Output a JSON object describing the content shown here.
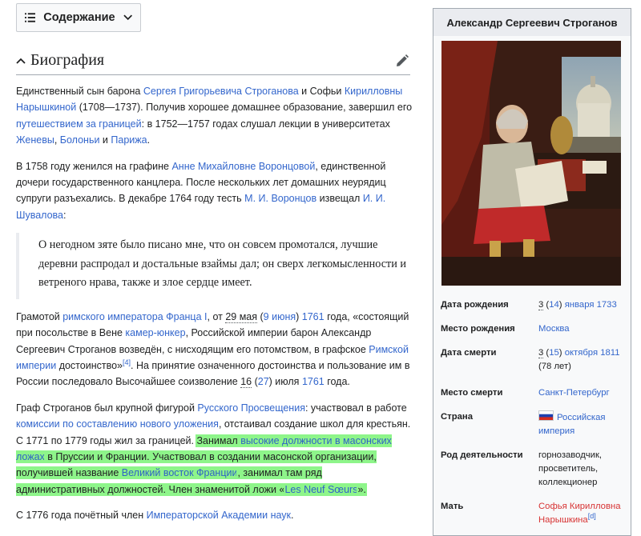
{
  "toc": {
    "label": "Содержание"
  },
  "section": {
    "title": "Биография"
  },
  "p1": {
    "t1": "Единственный сын барона ",
    "l1": "Сергея Григорьевича Строганова",
    "t2": " и Софьи ",
    "l2": "Кирилловны Нарышкиной",
    "t3": " (1708—1737). Получив хорошее домашнее образование, завершил его ",
    "l3": "путешествием за границей",
    "t4": ": в 1752—1757 годах слушал лекции в университетах ",
    "l4": "Женевы",
    "t5": ", ",
    "l5": "Болоньи",
    "t6": " и ",
    "l6": "Парижа",
    "t7": "."
  },
  "p2": {
    "t1": "В 1758 году женился на графине ",
    "l1": "Анне Михайловне Воронцовой",
    "t2": ", единственной дочери государственного канцлера. После нескольких лет домашних неурядиц супруги разъехались. В декабре 1764 году тесть ",
    "l2": "М. И. Воронцов",
    "t3": " извещал ",
    "l3": "И. И. Шувалова",
    "t4": ":"
  },
  "quote": "О негодном зяте было писано мне, что он совсем промотался, лучшие деревни распродал и достальные взаймы дал; он сверх легкомысленности и ветреного нрава, также и злое сердце имеет.",
  "p3": {
    "t1": "Грамотой ",
    "l1": "римского императора Франца I",
    "t2": ", от ",
    "d1": "29 мая",
    "t3": " (",
    "l2": "9 июня",
    "t4": ") ",
    "l3": "1761",
    "t5": " года, «состоящий при посольстве в Вене ",
    "l4": "камер-юнкер",
    "t6": ", Российской империи барон Александр Сергеевич Строганов возведён, с нисходящим его потомством, в графское ",
    "l5": "Римской империи",
    "t7": " достоинство»",
    "s1": "[4]",
    "t8": ". На принятие означенного достоинства и пользование им в России последовало Высочайшее соизволение ",
    "d2": "16",
    "t9": " (",
    "l6": "27",
    "t10": ") июля ",
    "l7": "1761",
    "t11": " года."
  },
  "p4": {
    "t1": "Граф Строганов был крупной фигурой ",
    "l1": "Русского Просвещения",
    "t2": ": участвовал в работе ",
    "l2": "комиссии по составлению нового уложения",
    "t3": ", отстаивал создание школ для крестьян. С 1771 по 1779 годы жил за границей. ",
    "h1": "Занимал ",
    "hl1": "высокие должности в масонских ложах",
    "h2": " в Пруссии и Франции. Участвовал в создании масонской организации, получившей название ",
    "hl2": "Великий восток Франции",
    "h3": ", занимал там ряд административных должностей. Член знаменитой ложи «",
    "hl3": "Les Neuf Sœurs",
    "h4": "»."
  },
  "p5": {
    "t1": "С 1776 года почётный член ",
    "l1": "Императорской Академии наук",
    "t2": "."
  },
  "infobox": {
    "title": "Александр Сергеевич Строганов",
    "birth_label": "Дата рождения",
    "birth_d": "3",
    "birth_t1": " (",
    "birth_l1": "14",
    "birth_t2": ") ",
    "birth_l2": "января 1733",
    "birthplace_label": "Место рождения",
    "birthplace": "Москва",
    "death_label": "Дата смерти",
    "death_d": "3",
    "death_t1": " (",
    "death_l1": "15",
    "death_t2": ") ",
    "death_l2": "октября 1811",
    "death_age": "(78 лет)",
    "deathplace_label": "Место смерти",
    "deathplace": "Санкт-Петербург",
    "country_label": "Страна",
    "country": "Российская империя",
    "occupation_label": "Род деятельности",
    "occupation": [
      "горнозаводчик,",
      "просветитель,",
      "коллекционер"
    ],
    "mother_label": "Мать",
    "mother": "Софья Кирилловна Нарышкина",
    "mother_sup": "[d]"
  }
}
